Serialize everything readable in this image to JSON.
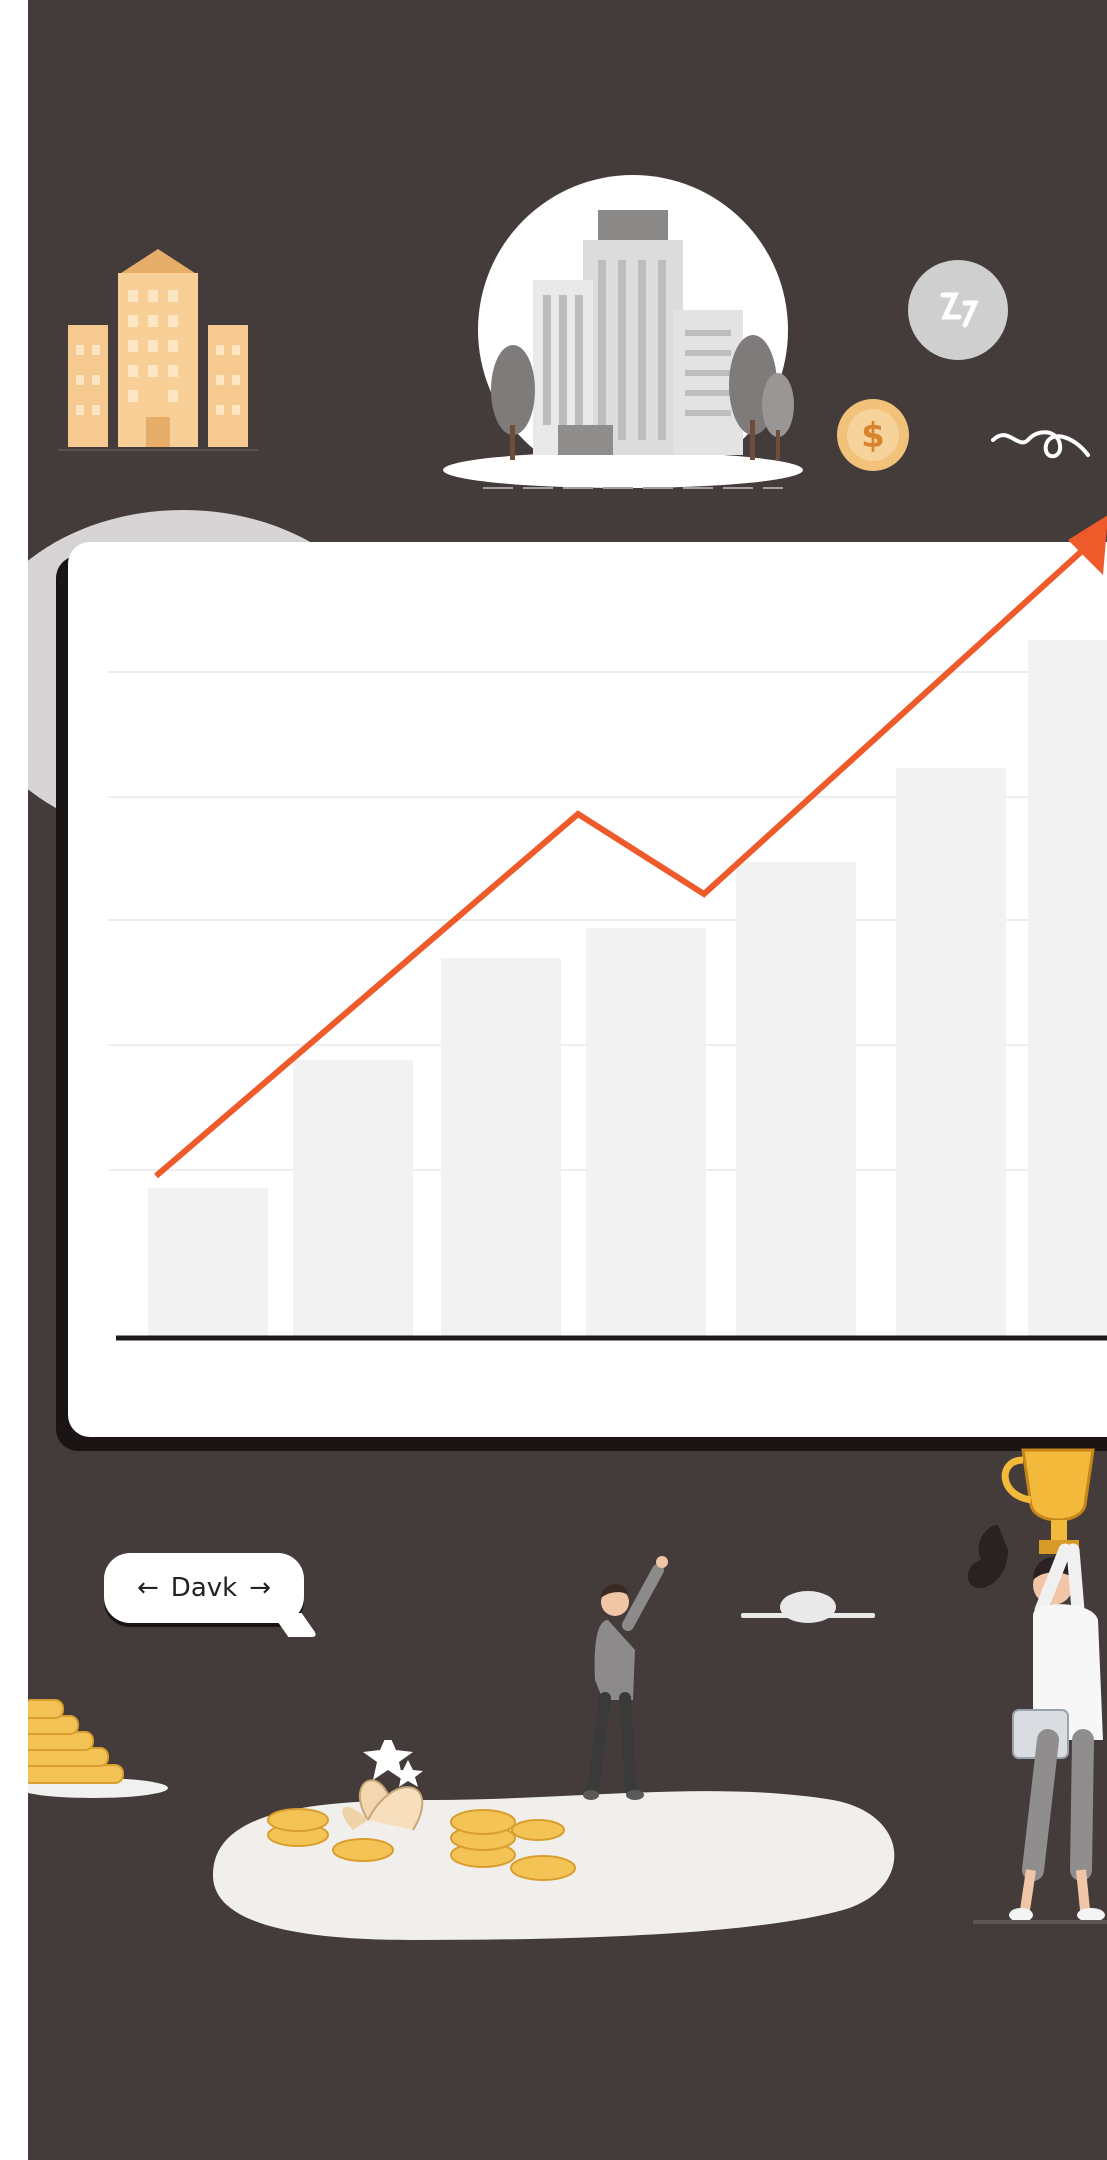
{
  "speech_bubble": {
    "arrow_left": "←",
    "text": "Davk",
    "arrow_right": "→"
  },
  "colors": {
    "background": "#443b3b",
    "card": "#ffffff",
    "trend_line": "#ee5a2a",
    "coin": "#f4c355",
    "building": "#f5c98f"
  },
  "icons": [
    "building-icon",
    "city-globe-icon",
    "lightning-badge-icon",
    "dollar-coin-icon",
    "squiggle-icon",
    "trophy-icon",
    "coins-icon"
  ]
}
